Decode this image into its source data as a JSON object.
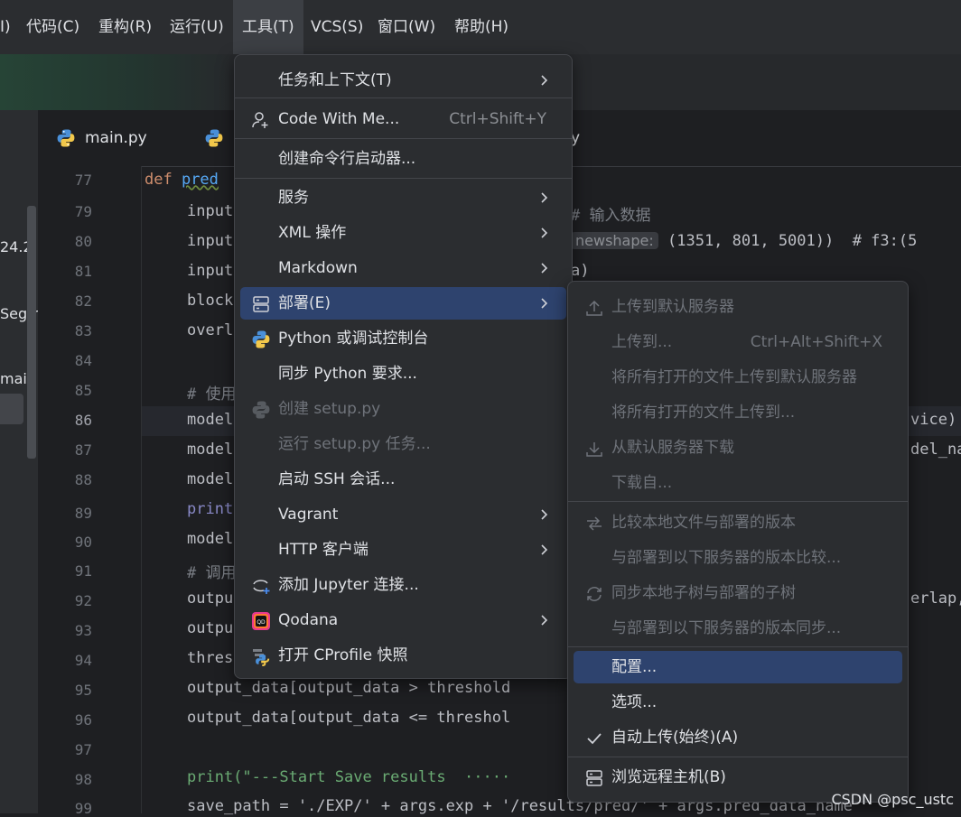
{
  "menubar": {
    "items": [
      "I)",
      "代码(C)",
      "重构(R)",
      "运行(U)",
      "工具(T)",
      "VCS(S)",
      "窗口(W)",
      "帮助(H)"
    ],
    "active_index": 4
  },
  "project_panel": {
    "fragments": [
      "24.2",
      "Seg-r",
      "main"
    ]
  },
  "tabs": [
    {
      "label": "main.py"
    },
    {
      "label": "y"
    }
  ],
  "editor": {
    "current_line": "86",
    "lines": [
      {
        "no": "77",
        "code": "def pred"
      },
      {
        "no": "79",
        "code": "input",
        "tail": "# 输入数据"
      },
      {
        "no": "80",
        "code": "input",
        "hint": "newshape:",
        "tail": "(1351, 801, 5001))  # f3:(5"
      },
      {
        "no": "81",
        "code": "input",
        "tail": "a)"
      },
      {
        "no": "82",
        "code": "block"
      },
      {
        "no": "83",
        "code": "overl"
      },
      {
        "no": "84",
        "code": ""
      },
      {
        "no": "85",
        "code": "# 使用"
      },
      {
        "no": "86",
        "code": "model",
        "tail": "vice)"
      },
      {
        "no": "87",
        "code": "model",
        "tail": "del_na"
      },
      {
        "no": "88",
        "code": "model"
      },
      {
        "no": "89",
        "code": "print"
      },
      {
        "no": "90",
        "code": "model"
      },
      {
        "no": "91",
        "code": "# 调用"
      },
      {
        "no": "92",
        "code": "outpu",
        "tail": "erlap,"
      },
      {
        "no": "93",
        "code": "outpu"
      },
      {
        "no": "94",
        "code": "thres"
      },
      {
        "no": "95",
        "code": "output_data[output_data > threshold"
      },
      {
        "no": "96",
        "code": "output_data[output_data <= threshol"
      },
      {
        "no": "97",
        "code": ""
      },
      {
        "no": "98",
        "code": "print(\"---Start Save results  ·····"
      },
      {
        "no": "99",
        "code": "save_path = './EXP/' + args.exp + '/results/pred/' + args.pred_data_name"
      }
    ]
  },
  "tools_menu": {
    "items": [
      {
        "label": "任务和上下文(T)",
        "submenu": true
      },
      {
        "label": "Code With Me...",
        "shortcut": "Ctrl+Shift+Y",
        "icon": "user-add-icon"
      },
      {
        "label": "创建命令行启动器..."
      },
      {
        "label": "服务",
        "submenu": true
      },
      {
        "label": "XML 操作",
        "submenu": true
      },
      {
        "label": "Markdown",
        "submenu": true
      },
      {
        "label": "部署(E)",
        "submenu": true,
        "selected": true,
        "icon": "server-icon"
      },
      {
        "label": "Python 或调试控制台",
        "icon": "python-icon"
      },
      {
        "label": "同步 Python 要求..."
      },
      {
        "label": "创建 setup.py",
        "disabled": true,
        "icon": "python-icon"
      },
      {
        "label": "运行 setup.py 任务...",
        "disabled": true
      },
      {
        "label": "启动 SSH 会话..."
      },
      {
        "label": "Vagrant",
        "submenu": true
      },
      {
        "label": "HTTP 客户端",
        "submenu": true
      },
      {
        "label": "添加 Jupyter 连接...",
        "icon": "jupyter-icon"
      },
      {
        "label": "Qodana",
        "submenu": true,
        "icon": "qodana-icon"
      },
      {
        "label": "打开 CProfile 快照",
        "icon": "cprofile-icon"
      }
    ]
  },
  "deploy_menu": {
    "items": [
      {
        "label": "上传到默认服务器",
        "disabled": true,
        "icon": "upload-icon"
      },
      {
        "label": "上传到...",
        "shortcut": "Ctrl+Alt+Shift+X",
        "disabled": true
      },
      {
        "label": "将所有打开的文件上传到默认服务器",
        "disabled": true
      },
      {
        "label": "将所有打开的文件上传到...",
        "disabled": true
      },
      {
        "label": "从默认服务器下载",
        "disabled": true,
        "icon": "download-icon"
      },
      {
        "label": "下载自...",
        "disabled": true
      },
      {
        "label": "比较本地文件与部署的版本",
        "disabled": true,
        "icon": "compare-icon"
      },
      {
        "label": "与部署到以下服务器的版本比较...",
        "disabled": true
      },
      {
        "label": "同步本地子树与部署的子树",
        "disabled": true,
        "icon": "sync-icon"
      },
      {
        "label": "与部署到以下服务器的版本同步...",
        "disabled": true
      },
      {
        "label": "配置...",
        "selected": true
      },
      {
        "label": "选项..."
      },
      {
        "label": "自动上传(始终)(A)",
        "checked": true
      },
      {
        "label": "浏览远程主机(B)",
        "icon": "server-icon"
      }
    ]
  },
  "watermark": "CSDN @psc_ustc",
  "colors": {
    "menu_bg": "#2b2d30",
    "selection": "#2e436e",
    "editor_bg": "#1e1f22",
    "keyword": "#cf8e6d",
    "function": "#56a8f5"
  }
}
